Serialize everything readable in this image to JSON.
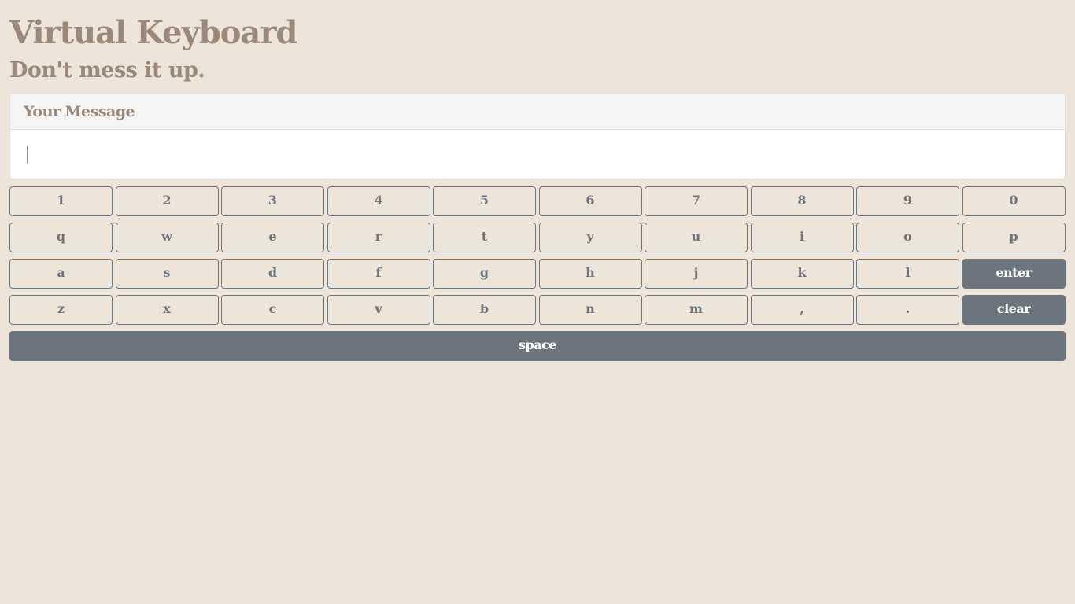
{
  "header": {
    "title": "Virtual Keyboard",
    "subtitle": "Don't mess it up."
  },
  "message": {
    "label": "Your Message",
    "value": ""
  },
  "keyboard": {
    "row1": [
      "1",
      "2",
      "3",
      "4",
      "5",
      "6",
      "7",
      "8",
      "9",
      "0"
    ],
    "row2": [
      "q",
      "w",
      "e",
      "r",
      "t",
      "y",
      "u",
      "i",
      "o",
      "p"
    ],
    "row3": [
      "a",
      "s",
      "d",
      "f",
      "g",
      "h",
      "j",
      "k",
      "l"
    ],
    "row3_action": "enter",
    "row4": [
      "z",
      "x",
      "c",
      "v",
      "b",
      "n",
      "m",
      ",",
      "."
    ],
    "row4_action": "clear",
    "space_label": "space"
  },
  "colors": {
    "background": "#ede4da",
    "heading": "#9a8878",
    "key_outline": "#6c757d",
    "key_filled": "#6c757d"
  }
}
